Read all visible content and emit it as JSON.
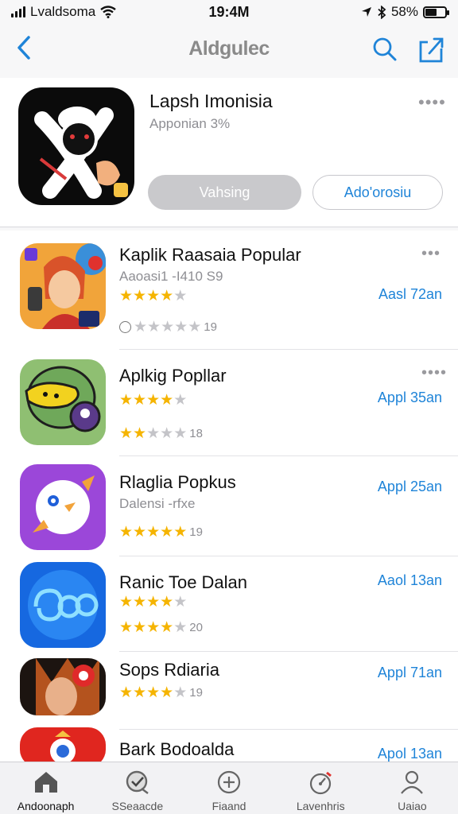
{
  "status": {
    "carrier": "Lvaldsoma",
    "time": "19:4M",
    "battery": "58%",
    "battery_level": 0.58
  },
  "nav": {
    "title": "Aldgulec"
  },
  "featured": {
    "title": "Lapsh Imonisia",
    "subtitle": "Apponian 3%",
    "primary_button": "Vahsing",
    "secondary_button": "Ado'orosiu",
    "more": "••••"
  },
  "apps": [
    {
      "name": "Kaplik Raasaia Popular",
      "subtitle": "Aaoasi1 -I410 S9",
      "rating_row1": 4,
      "rating_row2": 0,
      "count": "19",
      "action": "Aasl 72an",
      "more": "•••"
    },
    {
      "name": "Aplkig Popllar",
      "subtitle": "",
      "rating_row1": 4,
      "rating_row2": 2,
      "count": "18",
      "action": "Appl 35an",
      "more": "••••"
    },
    {
      "name": "Rlaglia Popkus",
      "subtitle": "Dalensi -rfxe",
      "rating_row1": 0,
      "rating_row2": 5,
      "count": "19",
      "action": "Appl 25an",
      "more": ""
    },
    {
      "name": "Ranic Toe Dalan",
      "subtitle": "",
      "rating_row1": 4,
      "rating_row2": 4,
      "count": "20",
      "action": "Aaol 13an",
      "more": ""
    },
    {
      "name": "Sops Rdiaria",
      "subtitle": "",
      "rating_row1": 0,
      "rating_row2": 4,
      "count": "19",
      "action": "Appl 71an",
      "more": ""
    },
    {
      "name": "Bark Bodoalda",
      "subtitle": "",
      "rating_row1": 0,
      "rating_row2": 0,
      "count": "",
      "action": "Apol 13an",
      "more": ""
    }
  ],
  "tabs": [
    {
      "label": "Andoonaph",
      "icon": "home-icon"
    },
    {
      "label": "SSeaacde",
      "icon": "chat-check-icon"
    },
    {
      "label": "Fiaand",
      "icon": "plus-circle-icon"
    },
    {
      "label": "Lavenhris",
      "icon": "stopwatch-icon"
    },
    {
      "label": "Uaiao",
      "icon": "person-icon"
    }
  ],
  "colors": {
    "accent": "#1f84d8",
    "star": "#f5b400",
    "button_gray": "#c9c9cc"
  }
}
